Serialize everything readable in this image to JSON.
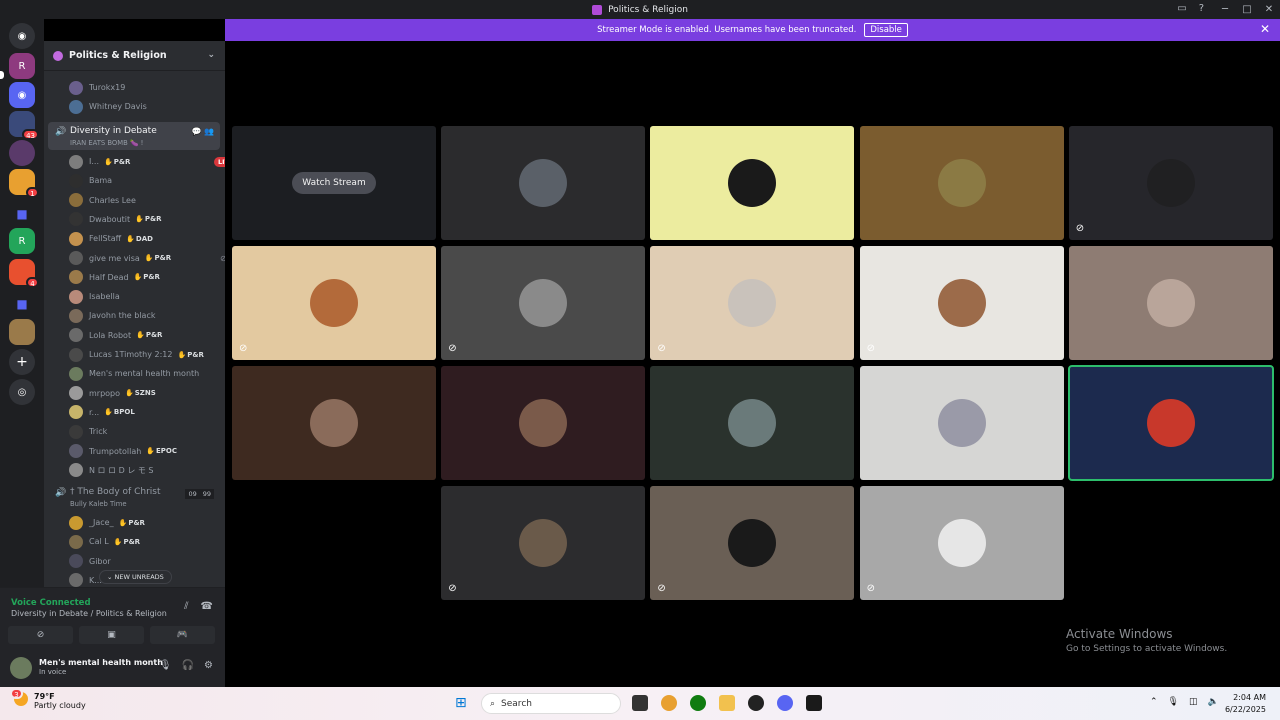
{
  "window": {
    "title": "Politics & Religion"
  },
  "notice": {
    "text": "Streamer Mode is enabled. Usernames have been truncated.",
    "button_label": "Disable",
    "close_glyph": "✕"
  },
  "rail": {
    "badges": [
      "43",
      "4",
      "1",
      "4"
    ]
  },
  "server": {
    "name": "Politics & Religion"
  },
  "members_top": [
    {
      "name": "Turokx19",
      "color": "#6a5f8c"
    },
    {
      "name": "Whitney Davis",
      "color": "#4c6e94"
    }
  ],
  "channel_active": {
    "name": "Diversity in Debate",
    "status": "IRAN EATS BOMB 🍆 !",
    "icons": "💬 👥"
  },
  "members": [
    {
      "name": "I...",
      "tag": "P&R",
      "live": "LIVE",
      "mute": "",
      "color": "#7d7d7d"
    },
    {
      "name": "Bama",
      "tag": "",
      "live": "",
      "mute": "",
      "color": "#2e2e2e"
    },
    {
      "name": "Charles Lee",
      "tag": "",
      "live": "",
      "mute": "",
      "color": "#8a6d3b"
    },
    {
      "name": "Dwaboutit",
      "tag": "P&R",
      "live": "",
      "mute": "⊘",
      "color": "#333333"
    },
    {
      "name": "FellStaff",
      "tag": "DAD",
      "live": "",
      "mute": "⊘",
      "color": "#c4924e"
    },
    {
      "name": "give me visa",
      "tag": "P&R",
      "live": "",
      "mute": "⊘ ⊘",
      "color": "#5a5a5a"
    },
    {
      "name": "Half Dead",
      "tag": "P&R",
      "live": "",
      "mute": "⊘",
      "color": "#9a7a4a"
    },
    {
      "name": "Isabella",
      "tag": "",
      "live": "",
      "mute": "⊘",
      "color": "#b88a7a"
    },
    {
      "name": "Javohn the black",
      "tag": "",
      "live": "",
      "mute": "",
      "color": "#7a6a5a"
    },
    {
      "name": "Lola Robot",
      "tag": "P&R",
      "live": "",
      "mute": "",
      "color": "#6a6a6a"
    },
    {
      "name": "Lucas 1Timothy 2:12",
      "tag": "P&R",
      "live": "",
      "mute": "",
      "color": "#4a4a4a"
    },
    {
      "name": "Men's mental health month",
      "tag": "",
      "live": "",
      "mute": "",
      "color": "#6b7b5e"
    },
    {
      "name": "mrpopo",
      "tag": "SZNS",
      "live": "",
      "mute": "",
      "color": "#9a9a9a"
    },
    {
      "name": "r...",
      "tag": "BPOL",
      "live": "",
      "mute": "",
      "color": "#c7b46a"
    },
    {
      "name": "Trick",
      "tag": "",
      "live": "",
      "mute": "⊘",
      "color": "#3a3a3a"
    },
    {
      "name": "Trumpotollah",
      "tag": "EPOC",
      "live": "",
      "mute": "⊘",
      "color": "#5a5a6a"
    },
    {
      "name": "N ロ ロ D レ モ S",
      "tag": "",
      "live": "",
      "mute": "⊘",
      "color": "#8a8a8a"
    }
  ],
  "channel_second": {
    "name": "† The Body of Christ",
    "status": "Bully Kaleb Time",
    "count_a": "09",
    "count_b": "99"
  },
  "members_second": [
    {
      "name": "_Jace_",
      "tag": "P&R",
      "mute": "",
      "color": "#c99a30"
    },
    {
      "name": "Cal L",
      "tag": "P&R",
      "mute": "⊘",
      "color": "#7a6a4a"
    },
    {
      "name": "Gibor",
      "tag": "",
      "mute": "",
      "color": "#4a4a5a"
    },
    {
      "name": "K...",
      "tag": "",
      "mute": "⊘",
      "color": "#6a6a6a"
    }
  ],
  "new_unreads": "NEW UNREADS",
  "voice": {
    "status": "Voice Connected",
    "location": "Diversity in Debate / Politics & Religion",
    "user_name": "Men's mental health month",
    "user_status": "In voice"
  },
  "tiles": [
    {
      "bg": "#1c1e22",
      "face": "",
      "watch": "Watch Stream",
      "mute": false,
      "speaking": false
    },
    {
      "bg": "#2b2b2d",
      "face": "#5a6068",
      "watch": "",
      "mute": false,
      "speaking": false
    },
    {
      "bg": "#ecec9f",
      "face": "#1a1a1a",
      "watch": "",
      "mute": false,
      "speaking": false
    },
    {
      "bg": "#7b5c2f",
      "face": "#8b7a44",
      "watch": "",
      "mute": false,
      "speaking": false
    },
    {
      "bg": "#26262b",
      "face": "#202022",
      "watch": "",
      "mute": true,
      "speaking": false
    },
    {
      "bg": "#e3c9a0",
      "face": "#b36a3a",
      "watch": "",
      "mute": true,
      "speaking": false
    },
    {
      "bg": "#4a4a4a",
      "face": "#8a8a8a",
      "watch": "",
      "mute": true,
      "speaking": false
    },
    {
      "bg": "#e0cdb4",
      "face": "#c9c2bb",
      "watch": "",
      "mute": true,
      "speaking": false
    },
    {
      "bg": "#e8e6e1",
      "face": "#9c6b4a",
      "watch": "",
      "mute": true,
      "speaking": false
    },
    {
      "bg": "#8e7c73",
      "face": "#b9a59a",
      "watch": "",
      "mute": false,
      "speaking": false
    },
    {
      "bg": "#3e2a20",
      "face": "#8a6b5a",
      "watch": "",
      "mute": false,
      "speaking": false
    },
    {
      "bg": "#2f1c20",
      "face": "#7a5a4a",
      "watch": "",
      "mute": false,
      "speaking": false
    },
    {
      "bg": "#2a322d",
      "face": "#6a7a7a",
      "watch": "",
      "mute": false,
      "speaking": false
    },
    {
      "bg": "#d6d6d4",
      "face": "#9a9aa8",
      "watch": "",
      "mute": false,
      "speaking": false
    },
    {
      "bg": "#1c2a4e",
      "face": "#c8382b",
      "watch": "",
      "mute": false,
      "speaking": true
    },
    {
      "bg": "#2c2c2e",
      "face": "#6a5a4a",
      "watch": "",
      "mute": true,
      "speaking": false
    },
    {
      "bg": "#6a5f55",
      "face": "#1a1a1a",
      "watch": "",
      "mute": true,
      "speaking": false
    },
    {
      "bg": "#a8a8a8",
      "face": "#e6e6e6",
      "watch": "",
      "mute": true,
      "speaking": false
    }
  ],
  "activate": {
    "title": "Activate Windows",
    "subtitle": "Go to Settings to activate Windows."
  },
  "taskbar": {
    "temp": "79°F",
    "condition": "Partly cloudy",
    "weather_badge": "3",
    "search_label": "Search",
    "time": "2:04 AM",
    "date": "6/22/2025"
  }
}
